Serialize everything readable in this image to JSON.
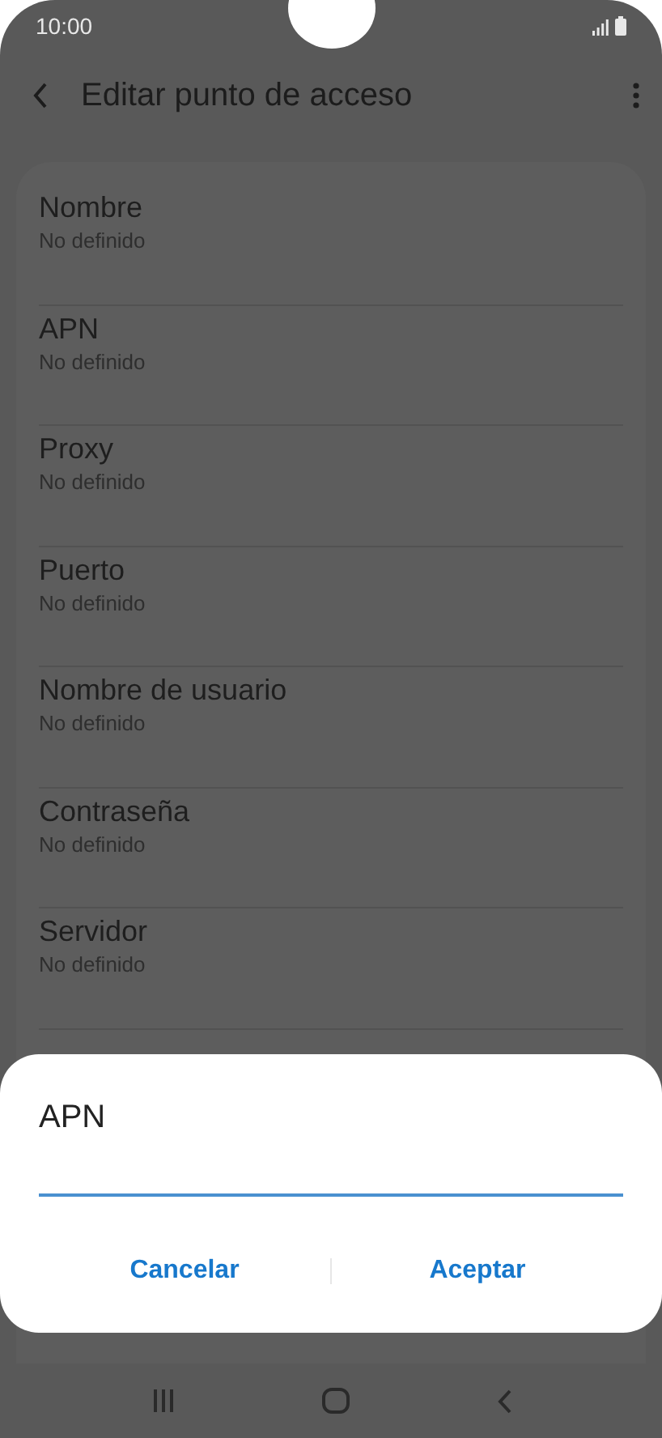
{
  "status_bar": {
    "time": "10:00"
  },
  "app_bar": {
    "title": "Editar punto de acceso"
  },
  "settings": [
    {
      "title": "Nombre",
      "value": "No definido"
    },
    {
      "title": "APN",
      "value": "No definido"
    },
    {
      "title": "Proxy",
      "value": "No definido"
    },
    {
      "title": "Puerto",
      "value": "No definido"
    },
    {
      "title": "Nombre de usuario",
      "value": "No definido"
    },
    {
      "title": "Contraseña",
      "value": "No definido"
    },
    {
      "title": "Servidor",
      "value": "No definido"
    }
  ],
  "dialog": {
    "title": "APN",
    "buttons": [
      "Cancelar",
      "Aceptar"
    ]
  }
}
